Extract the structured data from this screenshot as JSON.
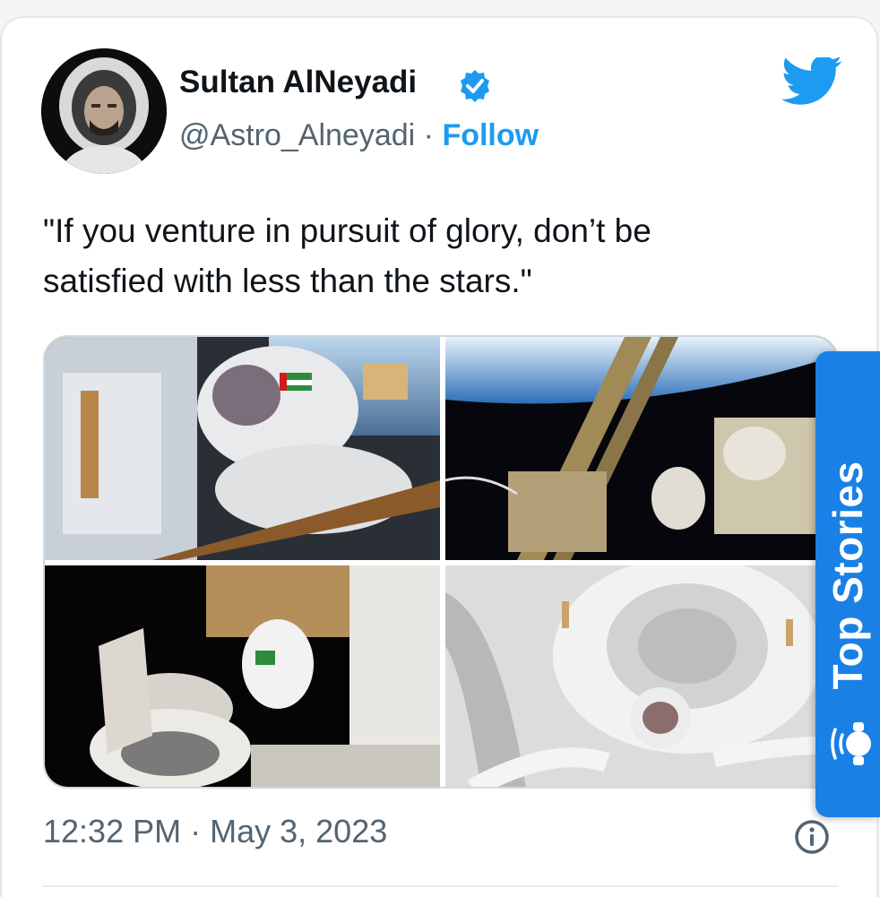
{
  "tweet": {
    "author": {
      "name": "Sultan AlNeyadi",
      "handle": "@Astro_Alneyadi",
      "separator": "·",
      "follow_label": "Follow",
      "verified": true
    },
    "text": "\"If you venture in pursuit of glory, don’t be satisfied with less than the stars.\"",
    "media": [
      {
        "alt": "astronaut-spacewalk-with-uae-flag"
      },
      {
        "alt": "astronaut-on-truss-over-earth"
      },
      {
        "alt": "astronaut-exiting-hatch"
      },
      {
        "alt": "astronaut-inside-airlock-module"
      }
    ],
    "time": "12:32 PM",
    "time_separator": "·",
    "date": "May 3, 2023"
  },
  "overlay": {
    "top_stories_label": "Top Stories"
  },
  "icons": {
    "bird": "twitter-bird-icon",
    "verified": "verified-badge-icon",
    "info": "info-icon",
    "top_stories": "news-icon"
  },
  "colors": {
    "accent": "#1d9bf0",
    "text": "#0f1419",
    "secondary": "#536471",
    "overlay": "#1a80e6"
  }
}
